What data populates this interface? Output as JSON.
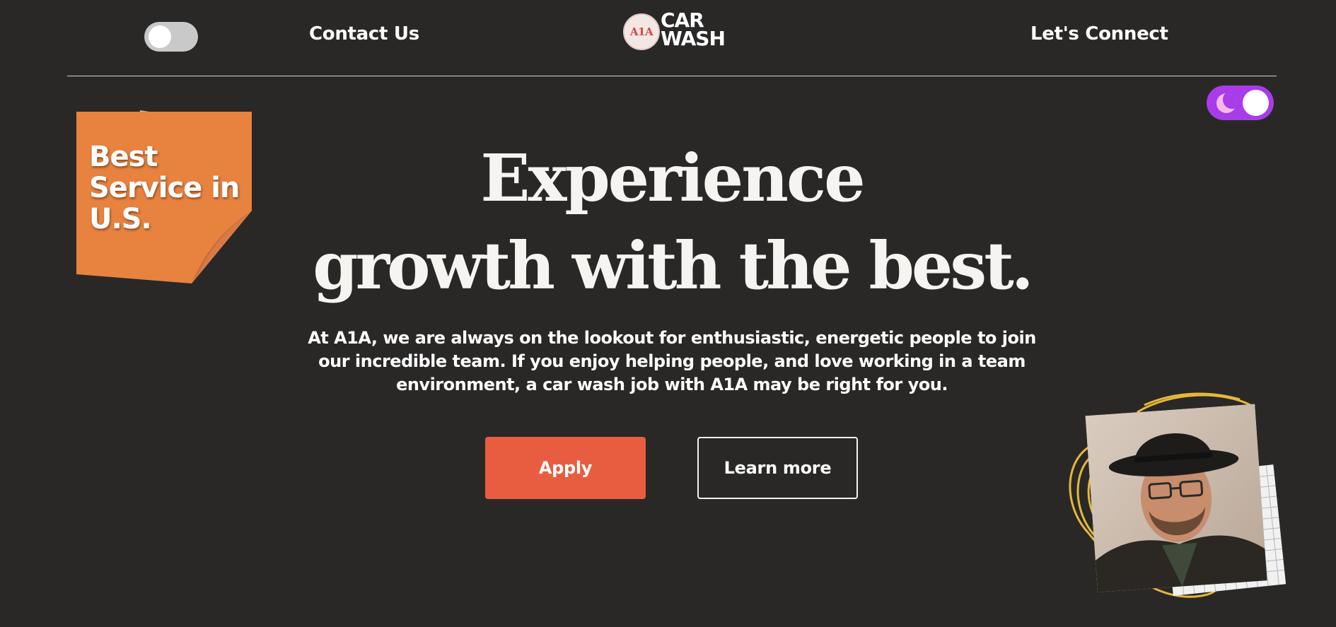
{
  "header": {
    "nav_left": "Contact Us",
    "nav_right": "Let's Connect",
    "logo": {
      "badge_text": "A1A",
      "line1": "CAR",
      "line2": "WASH"
    },
    "theme_toggle_state": "off"
  },
  "dark_mode_toggle": {
    "state": "on",
    "icon": "moon-icon"
  },
  "sticky_note": {
    "line1": "Best",
    "line2": "Service in",
    "line3": "U.S."
  },
  "hero": {
    "headline_line1": "Experience",
    "headline_line2": "growth with the best.",
    "description": "At A1A, we are always on the lookout for enthusiastic, energetic people to join our incredible team. If you enjoy helping people, and love working in a team environment, a car wash job with A1A may be right for you."
  },
  "buttons": {
    "apply": "Apply",
    "learn_more": "Learn more"
  },
  "colors": {
    "background": "#292827",
    "apply_button": "#e85d40",
    "dark_toggle": "#a73ce8",
    "sticky_note": "#e8823f",
    "scribble": "#e5b83a"
  }
}
